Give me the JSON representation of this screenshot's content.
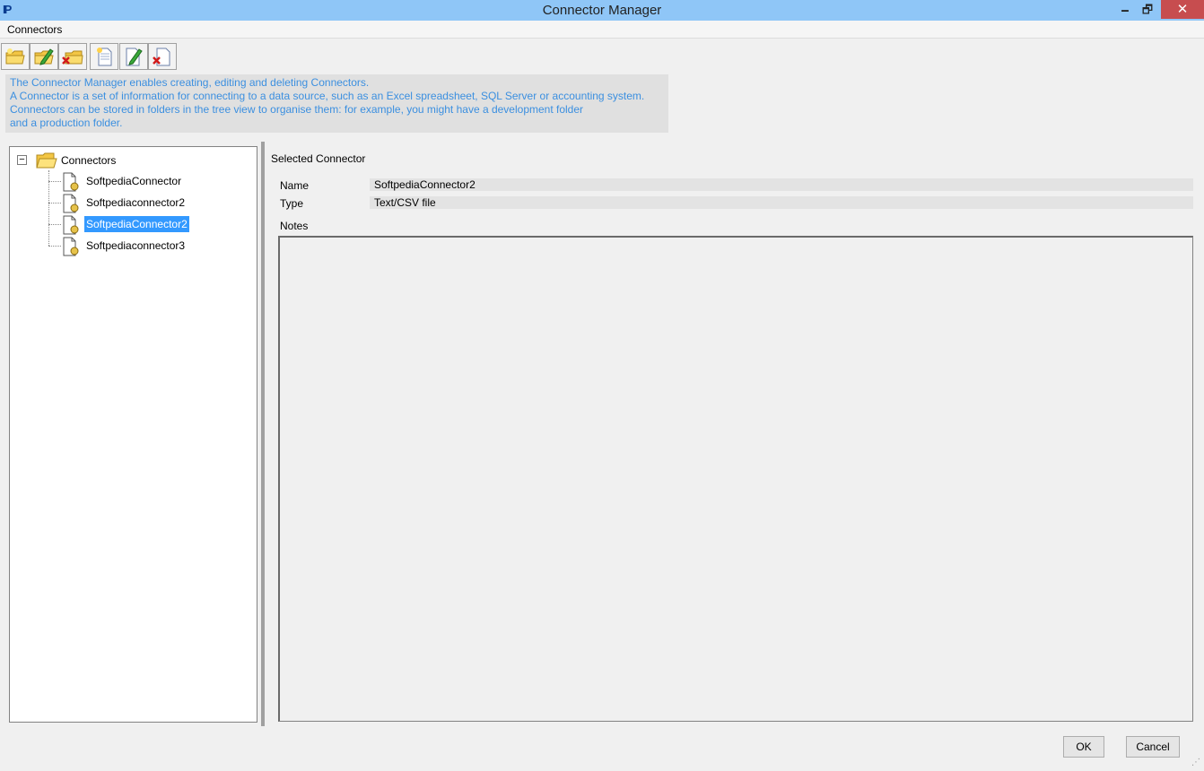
{
  "window": {
    "title": "Connector Manager",
    "minimize_glyph": "🗕",
    "maximize_glyph": "🗗",
    "close_glyph": "✕"
  },
  "menu": {
    "items": [
      {
        "label": "Connectors"
      }
    ]
  },
  "toolbar": {
    "buttons": [
      {
        "icon": "new-folder-icon"
      },
      {
        "icon": "edit-folder-icon"
      },
      {
        "icon": "delete-folder-icon"
      },
      {
        "icon": "new-connector-icon"
      },
      {
        "icon": "edit-connector-icon"
      },
      {
        "icon": "delete-connector-icon"
      }
    ]
  },
  "info": {
    "lines": [
      "The Connector Manager enables creating, editing and deleting Connectors.",
      "A Connector is a set of information for connecting to a data source, such as an Excel spreadsheet,  SQL Server or accounting system.",
      "Connectors can be stored in folders in the tree view to organise them: for example, you might have  a development folder",
      "and a production folder."
    ],
    "color": "#3b8fe0"
  },
  "tree": {
    "root": {
      "label": "Connectors",
      "expander": "−"
    },
    "nodes": [
      {
        "label": "SoftpediaConnector",
        "selected": false
      },
      {
        "label": "Softpediaconnector2",
        "selected": false
      },
      {
        "label": "SoftpediaConnector2",
        "selected": true
      },
      {
        "label": "Softpediaconnector3",
        "selected": false
      }
    ],
    "selection_color": "#3399ff"
  },
  "details": {
    "section_title": "Selected Connector",
    "name_label": "Name",
    "name_value": "SoftpediaConnector2",
    "type_label": "Type",
    "type_value": "Text/CSV file",
    "notes_label": "Notes",
    "notes_value": ""
  },
  "buttons": {
    "ok": "OK",
    "cancel": "Cancel"
  },
  "colors": {
    "titlebar": "#8fc6f7",
    "close_button": "#c74d4f"
  }
}
